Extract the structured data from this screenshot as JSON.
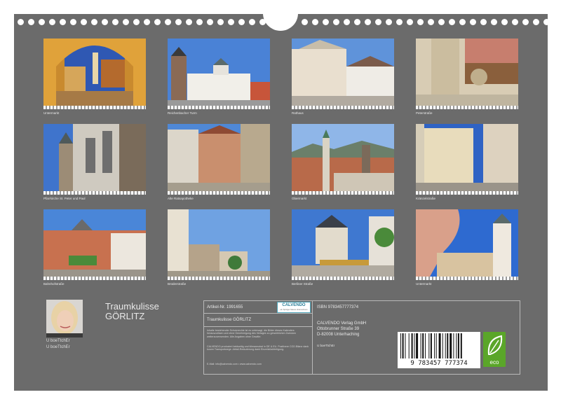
{
  "photos": [
    {
      "caption": "Untermarkt"
    },
    {
      "caption": "Reichenbacher Turm"
    },
    {
      "caption": "Rathaus"
    },
    {
      "caption": "Peterstraße"
    },
    {
      "caption": "Pfarrkirche St. Peter und Paul"
    },
    {
      "caption": "Alte Ratsapotheke"
    },
    {
      "caption": "Obermarkt"
    },
    {
      "caption": "Kränzelstraße"
    },
    {
      "caption": "Bahnhofstraße"
    },
    {
      "caption": "Brüderstraße"
    },
    {
      "caption": "Berliner Straße"
    },
    {
      "caption": "Untermarkt"
    }
  ],
  "author": {
    "line1": "U boeTtchEr",
    "line2": "U boeTtchEr"
  },
  "calendar": {
    "title_line1": "Traumkulisse",
    "title_line2": "GÖRLITZ"
  },
  "info": {
    "article_no": "Artikel-Nr. 1991655",
    "product_title": "Traumkulisse GÖRLITZ",
    "isbn": "ISBN 9783457777374",
    "publisher_line1": "CALVENDO Verlag GmbH",
    "publisher_line2": "Ottobrunner Straße 39",
    "publisher_line3": "D-82008 Unterhaching",
    "author_credit": "U boeTtchEr",
    "fineprint1": "Inhalte bestehender Schutzrechte ist es untersagt, die Bilder dieses Kalenders herauszulösen und ohne Genehmigung des Verlages zu gewerblichen Zwecken weiterzuverwenden. Alle Angaben ohne Gewähr.",
    "fineprint2": "CALVENDO produziert beidseitig und klimaneutral in DE & EU. Positivere CO2-Bilanz dank kurzer Transportwege. Abfall-Reduzierung dank Einzelstückfertigung.",
    "contact": "E-Mail: info@calvendo.com • www.calvendo.com"
  },
  "logo": {
    "brand": "CALVENDO",
    "tagline": "ein Springer Nature Unternehmen"
  },
  "barcode": {
    "number": "9 783457 777374"
  },
  "eco_label": "eco",
  "colors": {
    "board": "#6b6b6b",
    "eco_green": "#5aa629",
    "sky": "#3d6fc7"
  }
}
